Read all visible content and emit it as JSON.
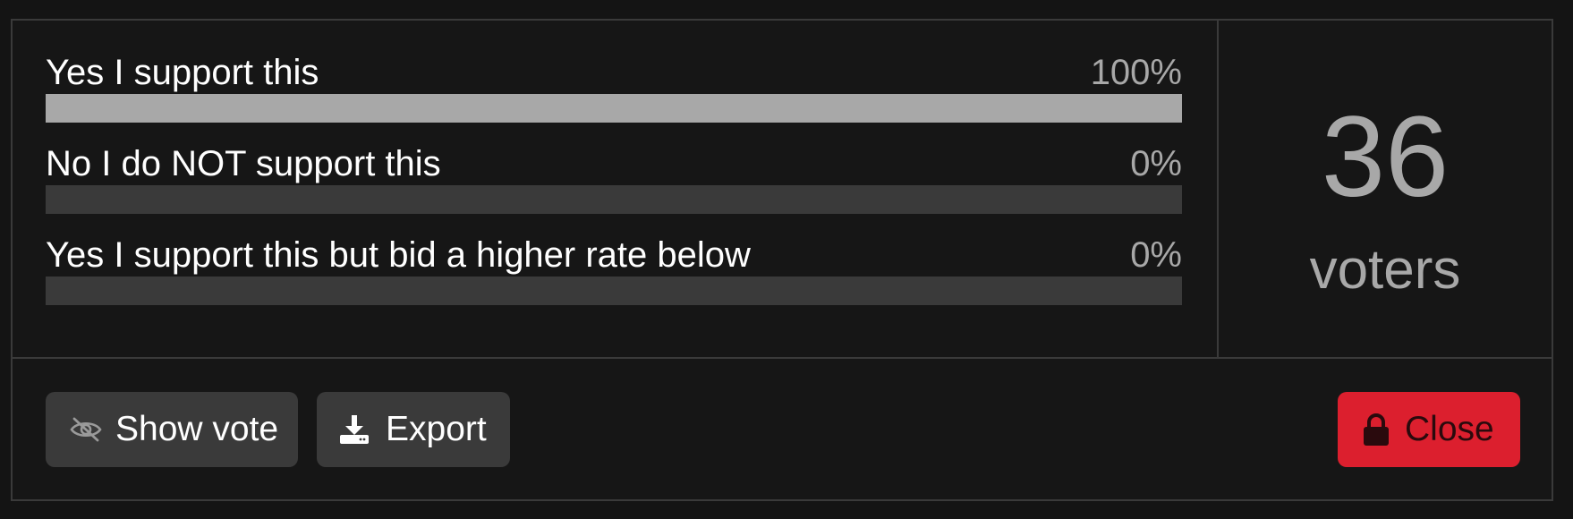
{
  "poll": {
    "options": [
      {
        "label": "Yes I support this",
        "percent_text": "100%",
        "fraction": 1.0
      },
      {
        "label": "No I do NOT support this",
        "percent_text": "0%",
        "fraction": 0.0
      },
      {
        "label": "Yes I support this but bid a higher rate below",
        "percent_text": "0%",
        "fraction": 0.0
      }
    ],
    "voter_count": "36",
    "voter_label": "voters"
  },
  "actions": {
    "show_vote_label": "Show vote",
    "export_label": "Export",
    "close_label": "Close"
  },
  "icons": {
    "show_vote": "eye-slash-icon",
    "export": "download-icon",
    "close": "lock-icon"
  },
  "colors": {
    "background": "#161616",
    "bar_fill": "#a8a8a8",
    "bar_track": "#3a3a3a",
    "close_button": "#dc1f2e"
  }
}
